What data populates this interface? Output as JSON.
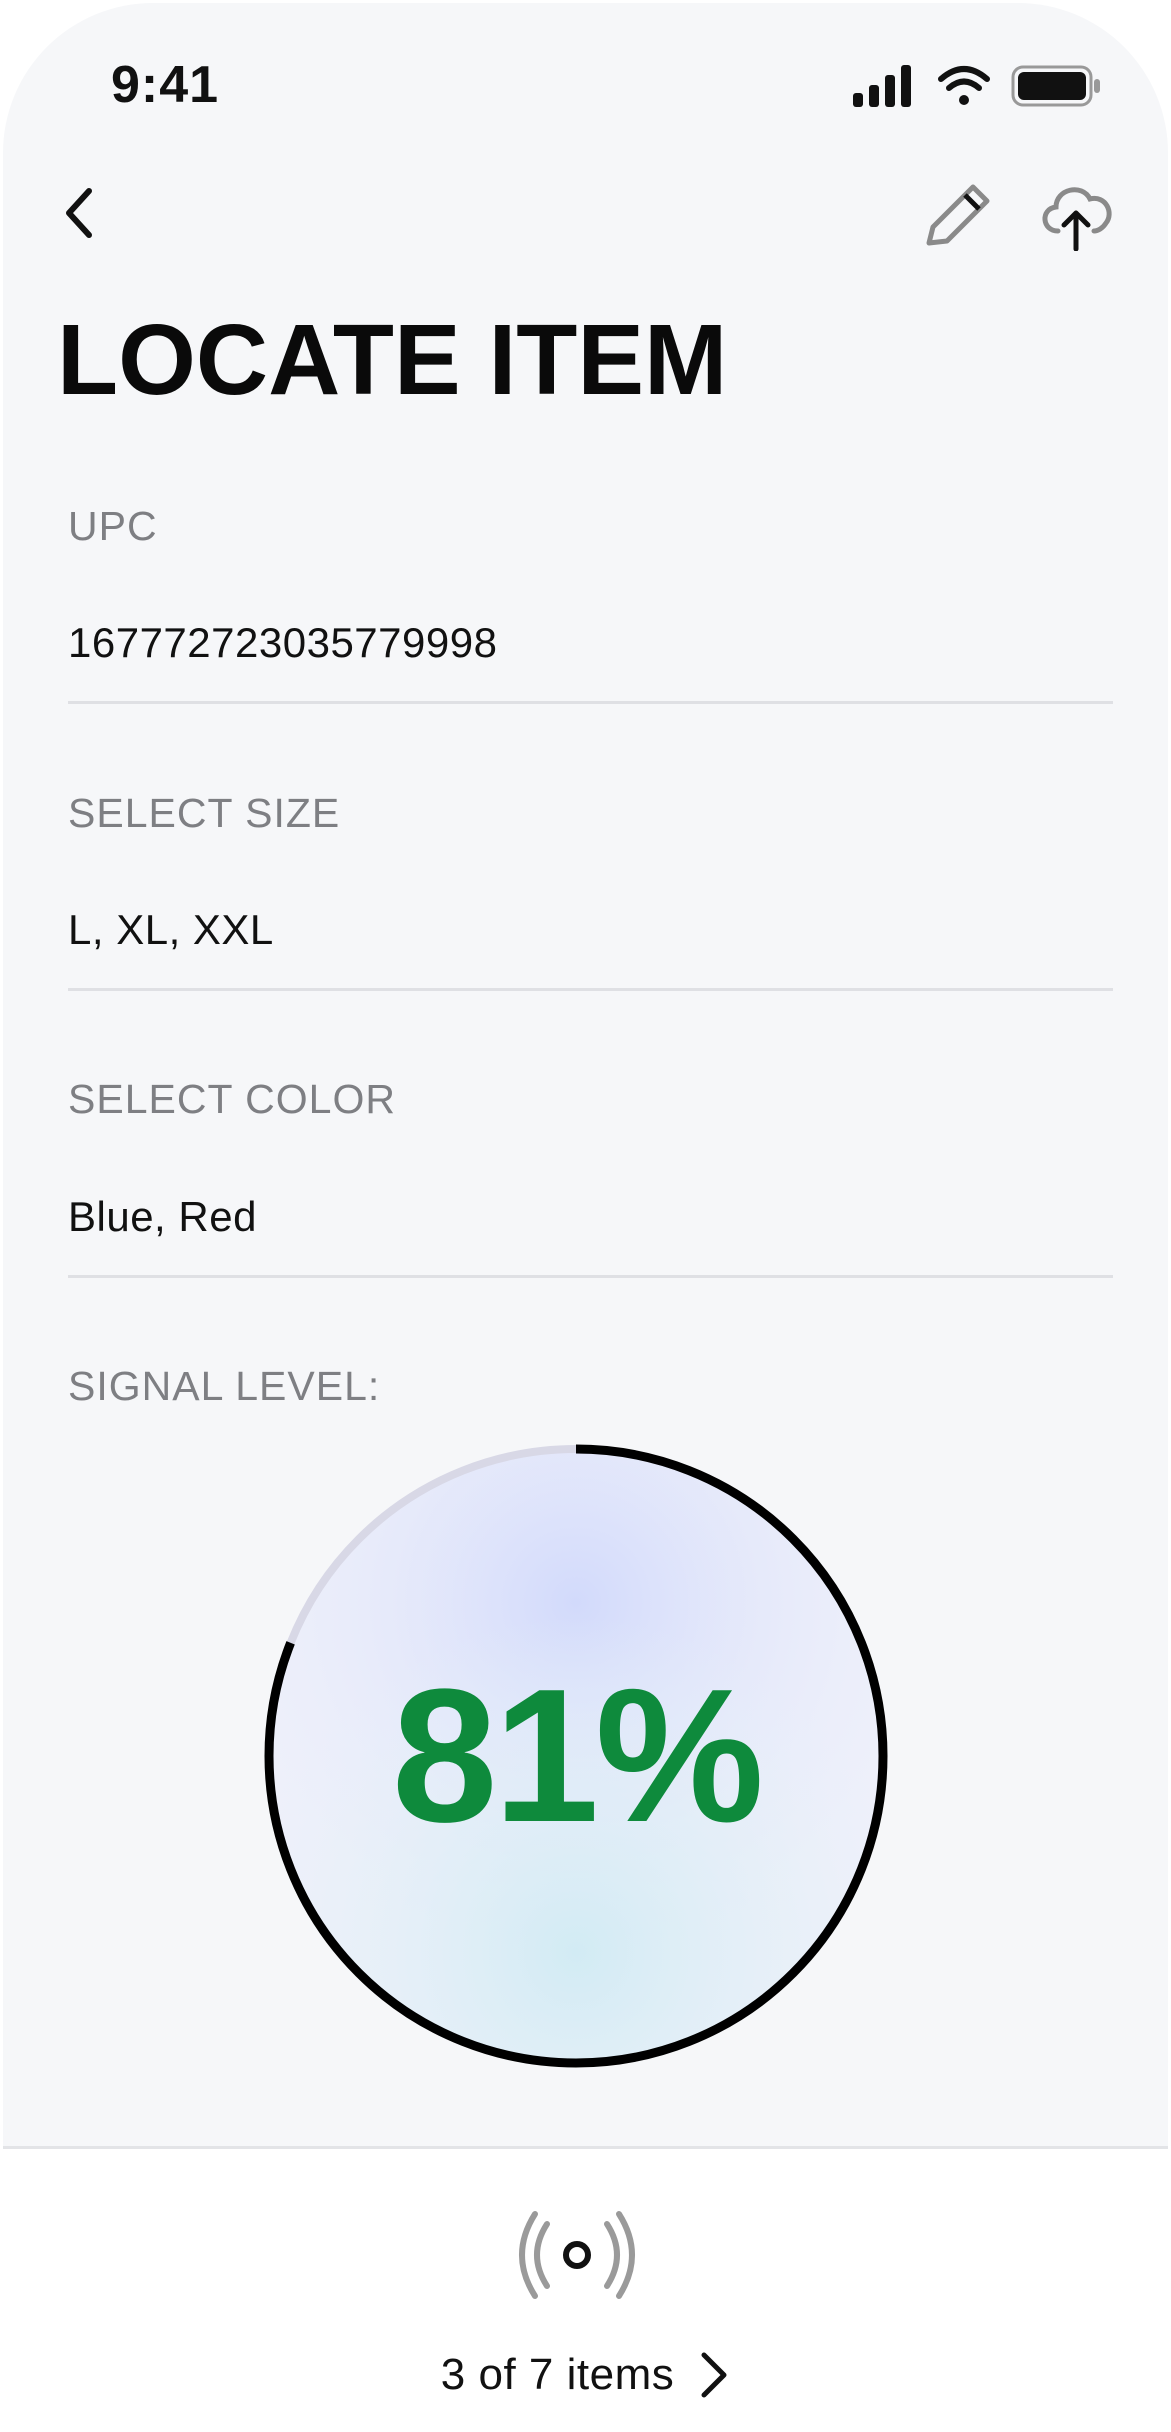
{
  "status_bar": {
    "time": "9:41"
  },
  "page": {
    "title": "LOCATE ITEM"
  },
  "fields": [
    {
      "label": "UPC",
      "value": "167772723035779998"
    },
    {
      "label": "SELECT SIZE",
      "value": "L, XL, XXL"
    },
    {
      "label": "SELECT COLOR",
      "value": "Blue, Red"
    }
  ],
  "signal": {
    "label": "SIGNAL LEVEL:",
    "value_text": "81%",
    "level": 0.81
  },
  "pager": {
    "text": "3 of 7 items"
  },
  "icons": {
    "back": "chevron-left-icon",
    "edit": "pencil-icon",
    "upload": "cloud-upload-icon",
    "scan": "rfid-scan-icon",
    "next": "chevron-right-icon"
  },
  "colors": {
    "accent_green": "#0e8a3c",
    "ring": "#000000",
    "track": "#dcdce6"
  }
}
